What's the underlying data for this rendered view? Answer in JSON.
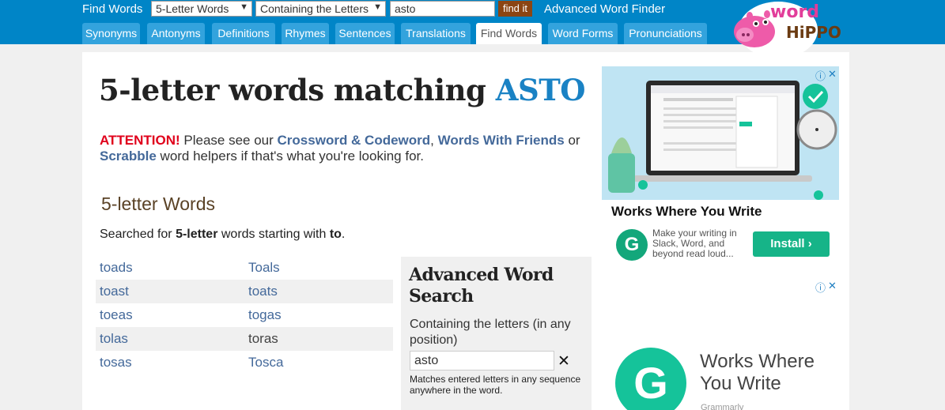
{
  "header": {
    "title": "Find Words",
    "type_select": "5-Letter Words",
    "mode_select": "Containing the Letters",
    "search_value": "asto",
    "find_button": "find it",
    "advanced_link": "Advanced Word Finder",
    "tabs": [
      {
        "label": "Synonyms"
      },
      {
        "label": "Antonyms"
      },
      {
        "label": "Definitions"
      },
      {
        "label": "Rhymes"
      },
      {
        "label": "Sentences"
      },
      {
        "label": "Translations"
      },
      {
        "label": "Find Words"
      },
      {
        "label": "Word Forms"
      },
      {
        "label": "Pronunciations"
      }
    ],
    "logo_top": "word",
    "logo_bottom": "HiPPO"
  },
  "main": {
    "heading_prefix": "5-letter words matching ",
    "heading_query": "ASTO",
    "attention_label": "ATTENTION!",
    "attention_text1": " Please see our ",
    "link_crossword": "Crossword & Codeword",
    "comma": ",",
    "link_wwf": "Words With Friends",
    "or_text": " or",
    "link_scrabble": "Scrabble",
    "attention_text2": " word helpers if that's what you're looking for.",
    "section_title": "5-letter Words",
    "searched_prefix": "Searched for ",
    "searched_bold1": "5-letter",
    "searched_mid": " words starting with ",
    "searched_bold2": "to",
    "searched_end": ".",
    "words": [
      [
        "toads",
        "Toals"
      ],
      [
        "toast",
        "toats"
      ],
      [
        "toeas",
        "togas"
      ],
      [
        "tolas",
        "toras"
      ],
      [
        "tosas",
        "Tosca"
      ]
    ]
  },
  "advanced": {
    "title_line1": "Advanced Word",
    "title_line2": "Search",
    "label": "Containing the letters (in any position)",
    "value": "asto",
    "clear": "✕",
    "note": "Matches entered letters in any sequence anywhere in the word."
  },
  "ads": {
    "info_icon": "ⓘ",
    "close_icon": "✕",
    "ad1_headline": "Works Where You Write",
    "ad1_logo": "G",
    "ad1_desc": "Make your writing in Slack, Word, and beyond read loud...",
    "ad1_button": "Install ›",
    "ad2_headline": "Works Where You Write",
    "ad2_logo": "G",
    "ad2_sub": "Grammarly"
  }
}
